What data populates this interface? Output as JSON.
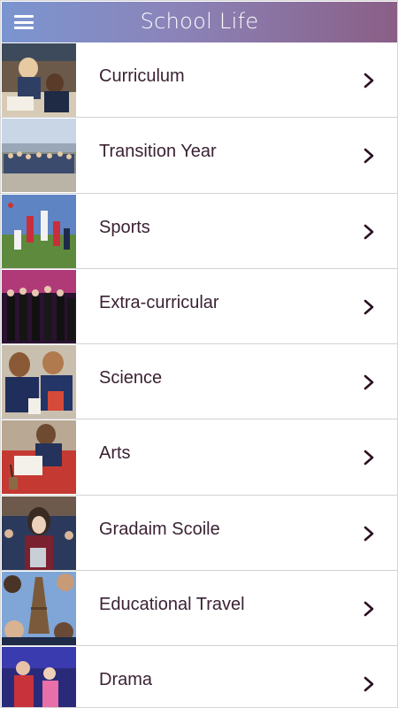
{
  "header": {
    "title": "School Life",
    "menu_icon": "hamburger-menu-icon"
  },
  "colors": {
    "header_gradient_start": "#7b95d0",
    "header_gradient_end": "#8a5f86",
    "label_text": "#3a2233",
    "chevron": "#2a1024"
  },
  "items": [
    {
      "label": "Curriculum",
      "icon": "chevron-right-icon"
    },
    {
      "label": "Transition Year",
      "icon": "chevron-right-icon"
    },
    {
      "label": "Sports",
      "icon": "chevron-right-icon"
    },
    {
      "label": "Extra-curricular",
      "icon": "chevron-right-icon"
    },
    {
      "label": "Science",
      "icon": "chevron-right-icon"
    },
    {
      "label": "Arts",
      "icon": "chevron-right-icon"
    },
    {
      "label": "Gradaim Scoile",
      "icon": "chevron-right-icon"
    },
    {
      "label": "Educational Travel",
      "icon": "chevron-right-icon"
    },
    {
      "label": "Drama",
      "icon": "chevron-right-icon"
    }
  ]
}
